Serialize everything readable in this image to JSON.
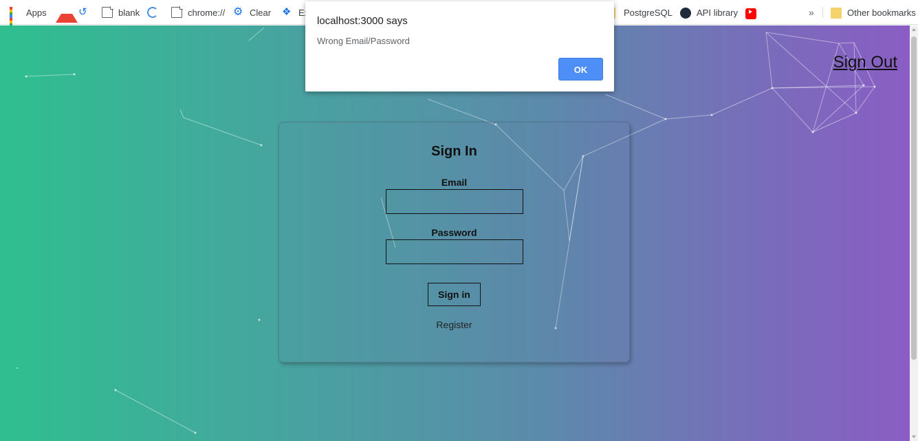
{
  "bookmarks": {
    "apps": "Apps",
    "items": [
      "blank",
      "chrome://",
      "Clear",
      "Ex",
      "PostgreSQL",
      "API library"
    ],
    "more": "»",
    "other": "Other bookmarks"
  },
  "header": {
    "signout": "Sign Out"
  },
  "form": {
    "title": "Sign In",
    "email_label": "Email",
    "email_value": "",
    "password_label": "Password",
    "password_value": "",
    "submit": "Sign in",
    "register": "Register"
  },
  "dialog": {
    "title": "localhost:3000 says",
    "message": "Wrong Email/Password",
    "ok": "OK"
  },
  "colors": {
    "gradient_start": "#2fbf8f",
    "gradient_end": "#8a5ec4",
    "ok_button": "#4d8ef7"
  }
}
